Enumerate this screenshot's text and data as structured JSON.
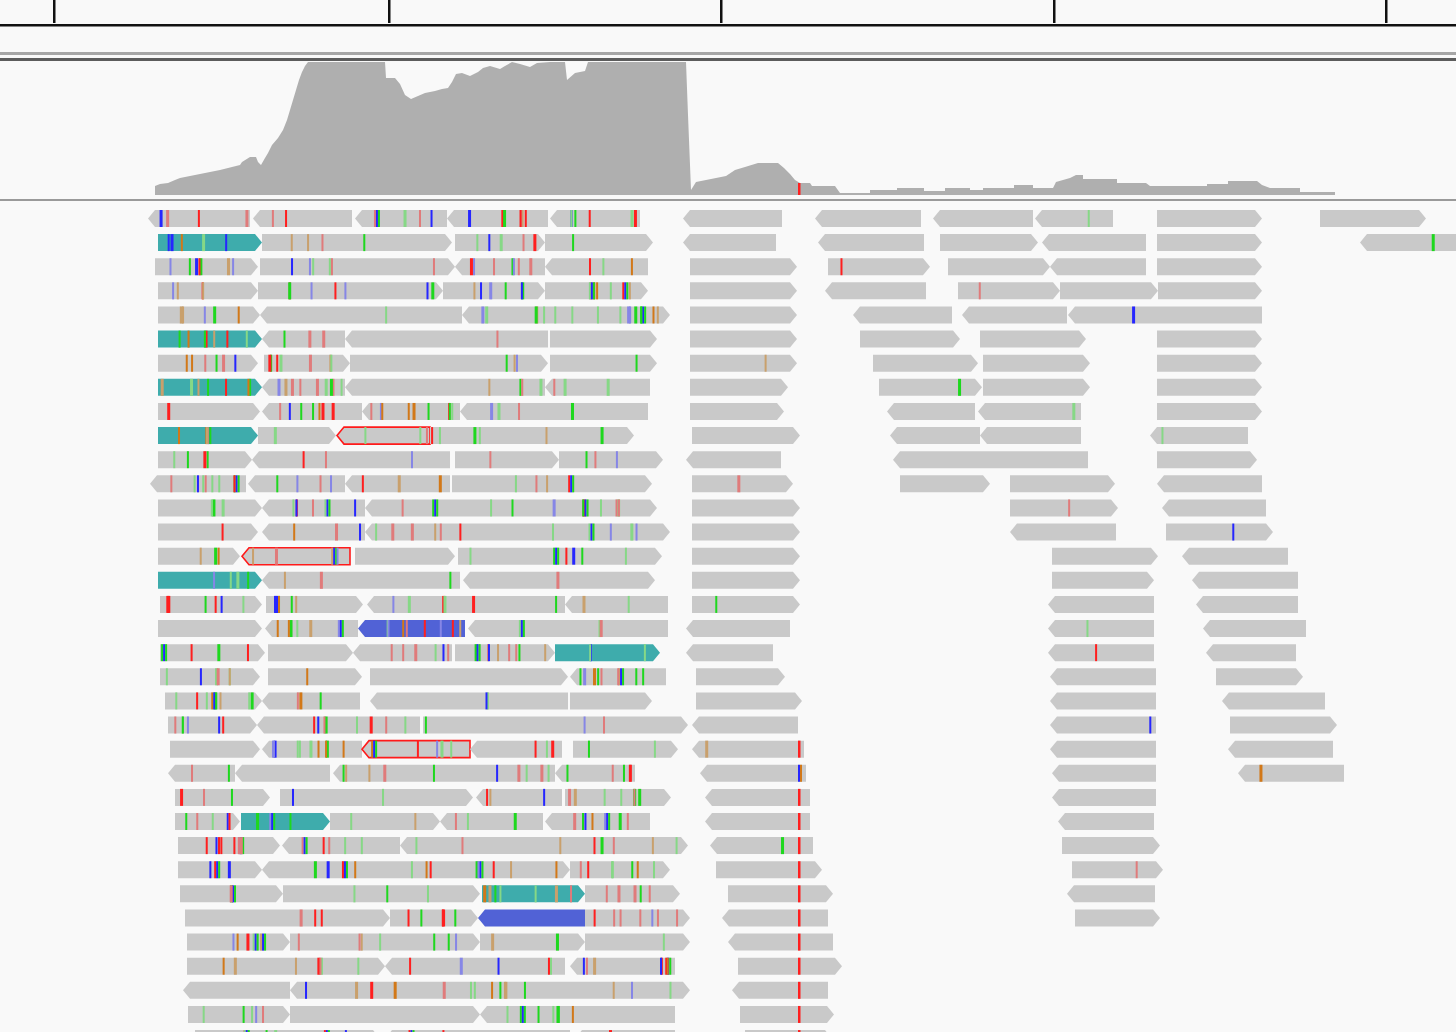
{
  "tracks": [
    {
      "kind": "ruler"
    },
    {
      "kind": "coverage"
    },
    {
      "kind": "alignments"
    }
  ]
}
